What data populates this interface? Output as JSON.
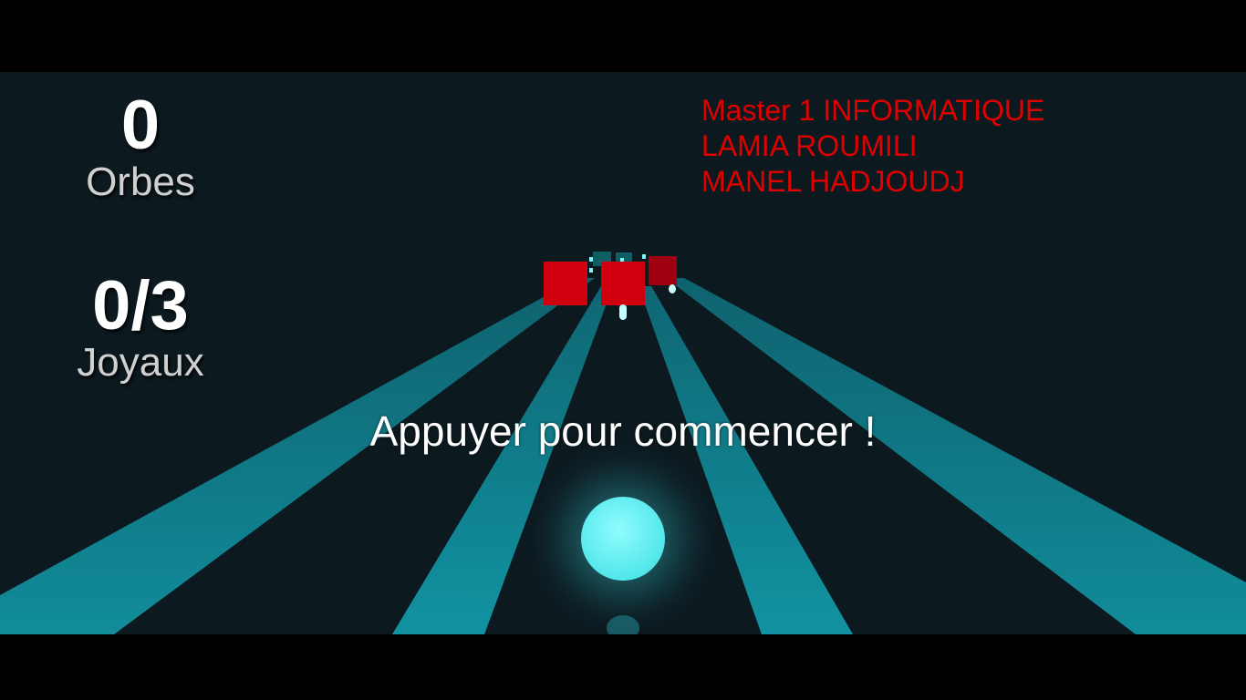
{
  "hud": {
    "orbs": {
      "value": "0",
      "label": "Orbes"
    },
    "gems": {
      "value": "0/3",
      "label": "Joyaux"
    }
  },
  "credits": {
    "line1": "Master 1 INFORMATIQUE",
    "line2": "LAMIA ROUMILI",
    "line3": "MANEL HADJOUDJ"
  },
  "prompt": "Appuyer pour commencer !",
  "colors": {
    "background": "#0c1a20",
    "lane": "#0f7f8c",
    "obstacle": "#d0000f",
    "ball": "#5ff3f5",
    "credits": "#e00000"
  }
}
